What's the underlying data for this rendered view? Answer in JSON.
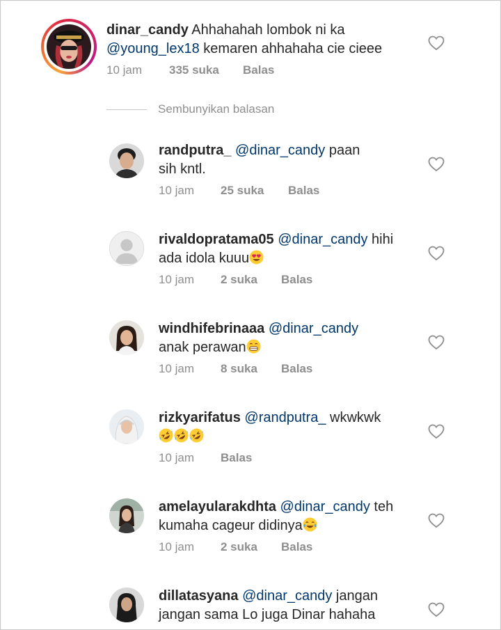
{
  "main_comment": {
    "username": "dinar_candy",
    "text_1": "Ahhahahah lombok ni ka",
    "mention": "@young_lex18",
    "text_2": " kemaren ahhahaha cie cieee",
    "time": "10 jam",
    "likes": "335 suka",
    "reply_label": "Balas",
    "heart_icon": "heart-outline-icon"
  },
  "hide_replies_label": "Sembunyikan balasan",
  "replies": [
    {
      "username": "randputra_",
      "mention": "@dinar_candy",
      "line1_text": " paan",
      "line2_text": "sih kntl.",
      "time": "10 jam",
      "likes": "25 suka",
      "reply_label": "Balas"
    },
    {
      "username": "rivaldopratama05",
      "mention": "@dinar_candy",
      "line1_text": " hihi",
      "line2_text": "ada idola kuuu",
      "emoji": "heart-eyes-emoji",
      "time": "10 jam",
      "likes": "2 suka",
      "reply_label": "Balas"
    },
    {
      "username": "windhifebrinaaa",
      "mention": "@dinar_candy",
      "line1_text": "",
      "line2_text": "anak perawan",
      "emoji": "grinning-emoji",
      "time": "10 jam",
      "likes": "8 suka",
      "reply_label": "Balas"
    },
    {
      "username": "rizkyarifatus",
      "mention": "@randputra_",
      "line1_text": " wkwkwk",
      "line2_text": "",
      "emoji": "rolling-laughing-emoji x3",
      "time": "10 jam",
      "likes": "",
      "reply_label": "Balas"
    },
    {
      "username": "amelayularakdhta",
      "mention": "@dinar_candy",
      "line1_text": " teh",
      "line2_text": "kumaha cageur didinya",
      "emoji": "tears-of-joy-emoji",
      "time": "10 jam",
      "likes": "2 suka",
      "reply_label": "Balas"
    },
    {
      "username": "dillatasyana",
      "mention": "@dinar_candy",
      "line1_text": " jangan",
      "line2_text": "jangan sama Lo juga Dinar hahaha",
      "time": "",
      "likes": "",
      "reply_label": ""
    }
  ],
  "colors": {
    "text": "#262626",
    "mention": "#00376b",
    "meta": "#8e8e8e",
    "divider": "#c7c7c7",
    "story_ring_start": "#f9a23a",
    "story_ring_end": "#bc1888"
  }
}
